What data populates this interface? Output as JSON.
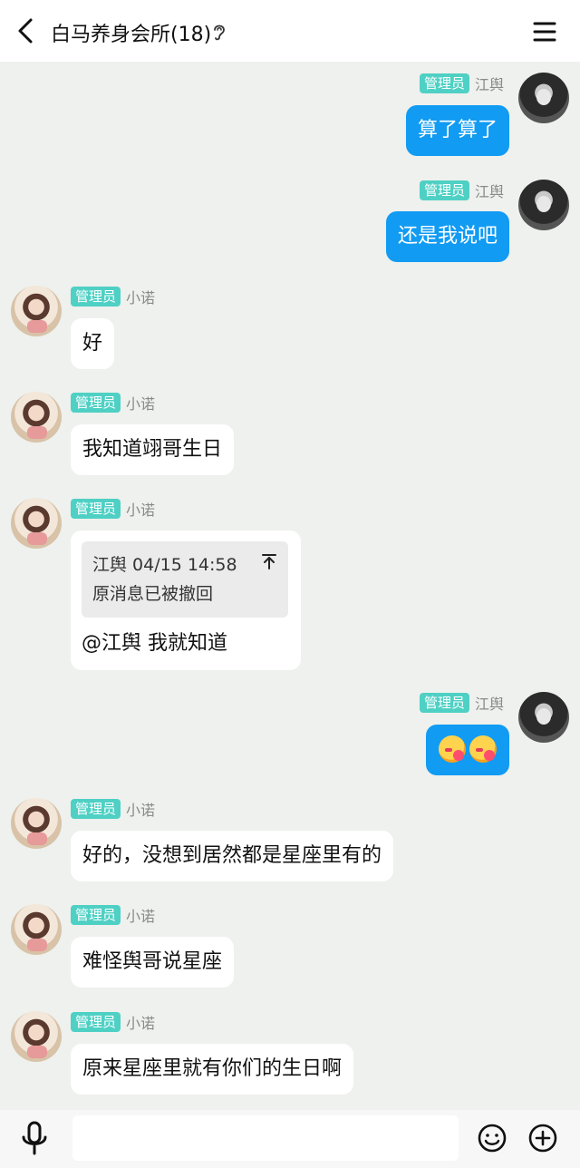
{
  "header": {
    "title": "白马养身会所(18)",
    "back_icon": "chevron-left-icon",
    "ear_icon": "ear-icon",
    "menu_icon": "hamburger-menu-icon"
  },
  "messages": [
    {
      "side": "out",
      "badge": "管理员",
      "name": "江舆",
      "text": "算了算了"
    },
    {
      "side": "out",
      "badge": "管理员",
      "name": "江舆",
      "text": "还是我说吧"
    },
    {
      "side": "in",
      "badge": "管理员",
      "name": "小诺",
      "text": "好"
    },
    {
      "side": "in",
      "badge": "管理员",
      "name": "小诺",
      "text": "我知道翊哥生日"
    },
    {
      "side": "in",
      "badge": "管理员",
      "name": "小诺",
      "quote": {
        "author_time": "江舆 04/15 14:58",
        "content": "原消息已被撤回"
      },
      "text": "@江舆 我就知道"
    },
    {
      "side": "out",
      "badge": "管理员",
      "name": "江舆",
      "emoji": [
        "face-savoring-food-emoji",
        "face-savoring-food-emoji"
      ]
    },
    {
      "side": "in",
      "badge": "管理员",
      "name": "小诺",
      "text": "好的，没想到居然都是星座里有的"
    },
    {
      "side": "in",
      "badge": "管理员",
      "name": "小诺",
      "text": "难怪舆哥说星座"
    },
    {
      "side": "in",
      "badge": "管理员",
      "name": "小诺",
      "text": "原来星座里就有你们的生日啊"
    }
  ],
  "bottom_bar": {
    "input_value": "",
    "mic_icon": "microphone-icon",
    "emoji_icon": "smiley-icon",
    "add_icon": "plus-circle-icon"
  },
  "colors": {
    "accent_blue": "#119bf3",
    "badge_teal": "#4fd0c4",
    "background": "#eef1ed"
  }
}
